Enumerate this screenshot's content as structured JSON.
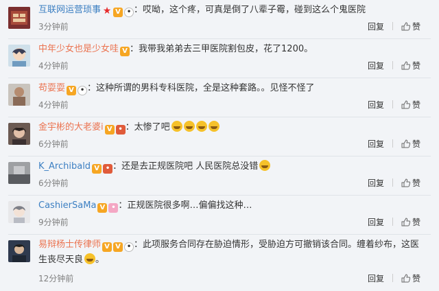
{
  "reply_label": "回复",
  "like_label": "赞",
  "comments": [
    {
      "username": "互联网运营琐事",
      "colon": "：",
      "text": "哎呦，这个疼，可真是倒了八辈子霉，碰到这么个鬼医院",
      "time": "3分钟前",
      "badges": [
        "star-icon",
        "vip-icon",
        "panda-icon"
      ]
    },
    {
      "username": "中年少女也是少女哇",
      "colon": "：",
      "text": "我带我弟弟去三甲医院割包皮，花了1200。",
      "time": "4分钟前",
      "badges": [
        "vip-icon"
      ]
    },
    {
      "username": "苟耍耍",
      "colon": "：",
      "text": "这种所谓的男科专科医院，全是这种套路。。见怪不怪了",
      "time": "4分钟前",
      "badges": [
        "vip-icon",
        "panda-icon"
      ]
    },
    {
      "username": "金宇彬的大老婆i",
      "colon": "：",
      "text": "太惨了吧",
      "time": "6分钟前",
      "badges": [
        "vip-icon",
        "red-badge-icon"
      ],
      "emojis": 4
    },
    {
      "username": "K_Archibald",
      "colon": "：",
      "text": "还是去正规医院吧 人民医院总没错",
      "time": "6分钟前",
      "badges": [
        "vip-icon",
        "red-badge-icon"
      ],
      "emojis": 1
    },
    {
      "username": "CashierSaMa",
      "colon": "：",
      "text": "正规医院很多啊…偏偏找这种…",
      "time": "9分钟前",
      "badges": [
        "vip-icon",
        "pink-badge-icon"
      ]
    },
    {
      "username": "易辩杨士传律师",
      "colon": "：",
      "text": "此项服务合同存在胁迫情形，受胁迫方可撤销该合同。缠着纱布，这医生丧尽天良",
      "text_end": "。",
      "time": "12分钟前",
      "badges": [
        "v-icon",
        "vip-icon",
        "panda-icon"
      ],
      "emojis": 1
    }
  ],
  "colors": {
    "link": "#eb7350",
    "time": "#808080",
    "bg": "#f2f4f7"
  }
}
